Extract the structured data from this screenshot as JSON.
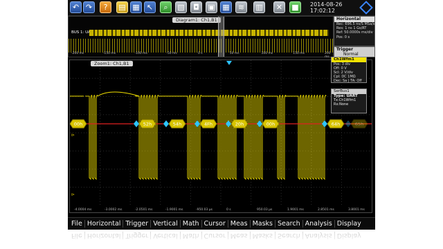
{
  "toolbar": {
    "buttons": [
      {
        "name": "undo-icon",
        "glyph": "↶"
      },
      {
        "name": "redo-icon",
        "glyph": "↷"
      },
      {
        "name": "help-icon",
        "glyph": "?"
      },
      {
        "name": "open-folder-icon",
        "glyph": "▤"
      },
      {
        "name": "grid-layout-icon",
        "glyph": "▦"
      },
      {
        "name": "pointer-icon",
        "glyph": "↖"
      },
      {
        "name": "zoom-icon",
        "glyph": "⌕"
      },
      {
        "name": "measure-icon",
        "glyph": "▧"
      },
      {
        "name": "camera-icon",
        "glyph": "◘"
      },
      {
        "name": "overlay-icon",
        "glyph": "▣"
      },
      {
        "name": "save-icon",
        "glyph": "▦"
      },
      {
        "name": "waveform-icon",
        "glyph": "≋"
      },
      {
        "name": "copy-icon",
        "glyph": "▥"
      },
      {
        "name": "delete-icon",
        "glyph": "✕"
      },
      {
        "name": "run-stop-icon",
        "glyph": "■"
      }
    ],
    "date": "2014-08-26",
    "time": "17:02:12"
  },
  "diagram": {
    "title": "Diagram1: Ch1,B1",
    "bus_label": "BUS 1: UART",
    "axis_ticks": [
      "-200 ms",
      "-150 ms",
      "-100 ms",
      "-50 ms",
      "0 s",
      "50 ms",
      "100 ms",
      "150 ms",
      "200 ms"
    ]
  },
  "horizontal": {
    "title": "Horizontal",
    "lines": [
      "Rec: 696.5 ns/S  MSa/s",
      "Res: 1 ns    1 Gs/RT",
      "Ref: 50.0000s  ms/div",
      "Pos: 0 s"
    ]
  },
  "trigger": {
    "title": "Trigger",
    "mode": "Normal",
    "line": "A:    Start bit: B1"
  },
  "zoom": {
    "title": "Zoom1: Ch1,B1",
    "decode_labels": [
      "00h",
      "52h",
      "54h",
      "4Fh",
      "20h",
      "00h",
      "64h",
      "65h"
    ],
    "axis_ticks": [
      "-4.0004 ms",
      "-3.0002 ms",
      "-2.0501 ms",
      "-1.9001 ms",
      "-950.03 µs",
      "0 s",
      "950.03 µs",
      "1.9001 ms",
      "2.8501 ms",
      "3.8001 ms"
    ]
  },
  "channel_panel": {
    "title": "Ch1Wfm1",
    "lines": [
      "Pos: 3 div",
      "Off: 0 V",
      "Scl: 2 V/div",
      "Cpl: DC 1MΩ",
      "Dec: Sa | TA: Off"
    ]
  },
  "serbus_panel": {
    "title": "SerBus1",
    "type": "Type: UART",
    "lines": [
      "Tx:Ch1Wfm1",
      "Rx:None"
    ]
  },
  "menu": [
    "File",
    "Horizontal",
    "Trigger",
    "Vertical",
    "Math",
    "Cursor",
    "Meas",
    "Masks",
    "Search",
    "Analysis",
    "Display"
  ],
  "colors": {
    "waveform": "#f2e000",
    "decode": "#d8c400",
    "bus_line": "#e02020",
    "marker": "#2ec4ff"
  }
}
